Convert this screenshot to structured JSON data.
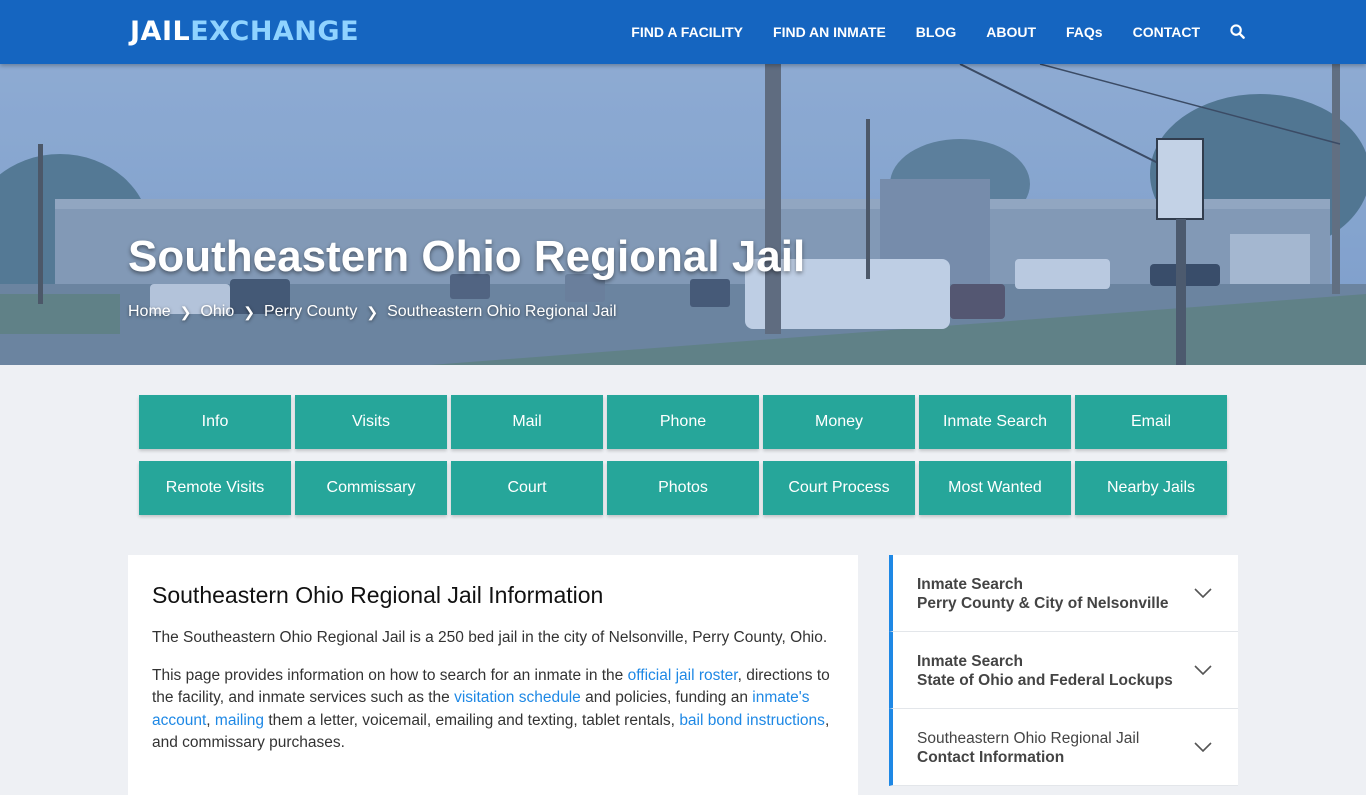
{
  "nav": {
    "logo_part1": "JAIL",
    "logo_part2": "EXCHANGE",
    "items": [
      "FIND A FACILITY",
      "FIND AN INMATE",
      "BLOG",
      "ABOUT",
      "FAQs",
      "CONTACT"
    ],
    "search_icon": "search-icon"
  },
  "hero": {
    "title": "Southeastern Ohio Regional Jail",
    "breadcrumb": [
      "Home",
      "Ohio",
      "Perry County",
      "Southeastern Ohio Regional Jail"
    ]
  },
  "tiles": {
    "row1": [
      "Info",
      "Visits",
      "Mail",
      "Phone",
      "Money",
      "Inmate Search",
      "Email"
    ],
    "row2": [
      "Remote Visits",
      "Commissary",
      "Court",
      "Photos",
      "Court Process",
      "Most Wanted",
      "Nearby Jails"
    ]
  },
  "main": {
    "heading": "Southeastern Ohio Regional Jail Information",
    "p1": "The Southeastern Ohio Regional Jail is a 250 bed jail in the city of Nelsonville, Perry County, Ohio.",
    "p2": {
      "t1": "This page provides information on how to search for an inmate in the ",
      "link1": "official jail roster",
      "t2": ", directions to the facility, and inmate services such as the ",
      "link2": "visitation schedule",
      "t3": " and policies, funding an ",
      "link3": "inmate's account",
      "t4": ", ",
      "link4": "mailing",
      "t5": " them a letter, voicemail, emailing and texting, tablet rentals, ",
      "link5": "bail bond instructions",
      "t6": ", and commissary purchases."
    }
  },
  "sidebar": {
    "items": [
      {
        "line1": "Inmate Search",
        "line2": "Perry County & City of Nelsonville"
      },
      {
        "line1": "Inmate Search",
        "line2": "State of Ohio and Federal Lockups"
      },
      {
        "line1": "Southeastern Ohio Regional Jail",
        "line2": "Contact Information"
      }
    ]
  },
  "colors": {
    "nav_bg": "#1565c0",
    "tile_bg": "#26a69a",
    "link": "#1e88e5",
    "accent_border": "#1e88e5"
  }
}
